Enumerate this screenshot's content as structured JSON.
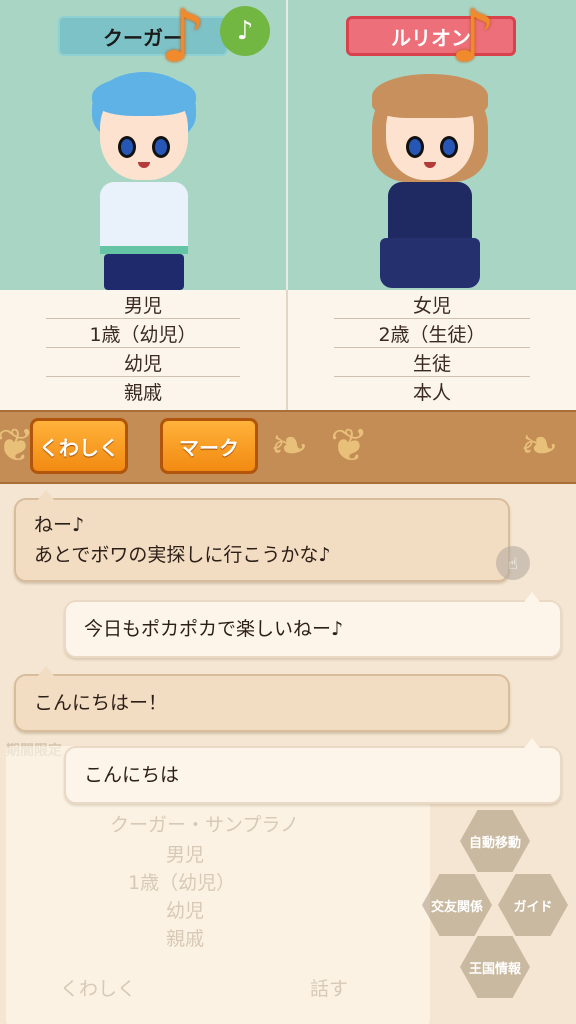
{
  "characters": {
    "left": {
      "name": "クーガー",
      "gender": "男児",
      "age": "1歳（幼児）",
      "stage": "幼児",
      "relation": "親戚"
    },
    "right": {
      "name": "ルリオン",
      "gender": "女児",
      "age": "2歳（生徒）",
      "stage": "生徒",
      "relation": "本人"
    }
  },
  "icons": {
    "note_badge": "♪",
    "note_big": "♪",
    "tap": "☝"
  },
  "buttons": {
    "detail": "くわしく",
    "mark": "マーク"
  },
  "chat": [
    {
      "speaker": "partner",
      "lines": [
        "ねー♪",
        "あとでボワの実探しに行こうかな♪"
      ]
    },
    {
      "speaker": "self",
      "lines": [
        "今日もポカポカで楽しいねー♪"
      ]
    },
    {
      "speaker": "partner",
      "lines": [
        "こんにちはー！"
      ]
    },
    {
      "speaker": "self",
      "lines": [
        "こんにちは"
      ]
    }
  ],
  "background_ui": {
    "limited_label": "期間限定",
    "card_title": "クーガー・サンプラノ",
    "card_rows": [
      "男児",
      "1歳（幼児）",
      "幼児",
      "親戚"
    ],
    "card_detail_button": "くわしく",
    "card_talk_button": "話す",
    "hex_buttons": [
      "自動移動",
      "交友関係",
      "ガイド",
      "王国情報"
    ]
  },
  "colors": {
    "panel_bg": "#a9d6c4",
    "boy_tag": "#7cc2c6",
    "girl_tag": "#ec6f7a",
    "button_orange": "#f28a12",
    "ornament_bar": "#c38d55"
  }
}
